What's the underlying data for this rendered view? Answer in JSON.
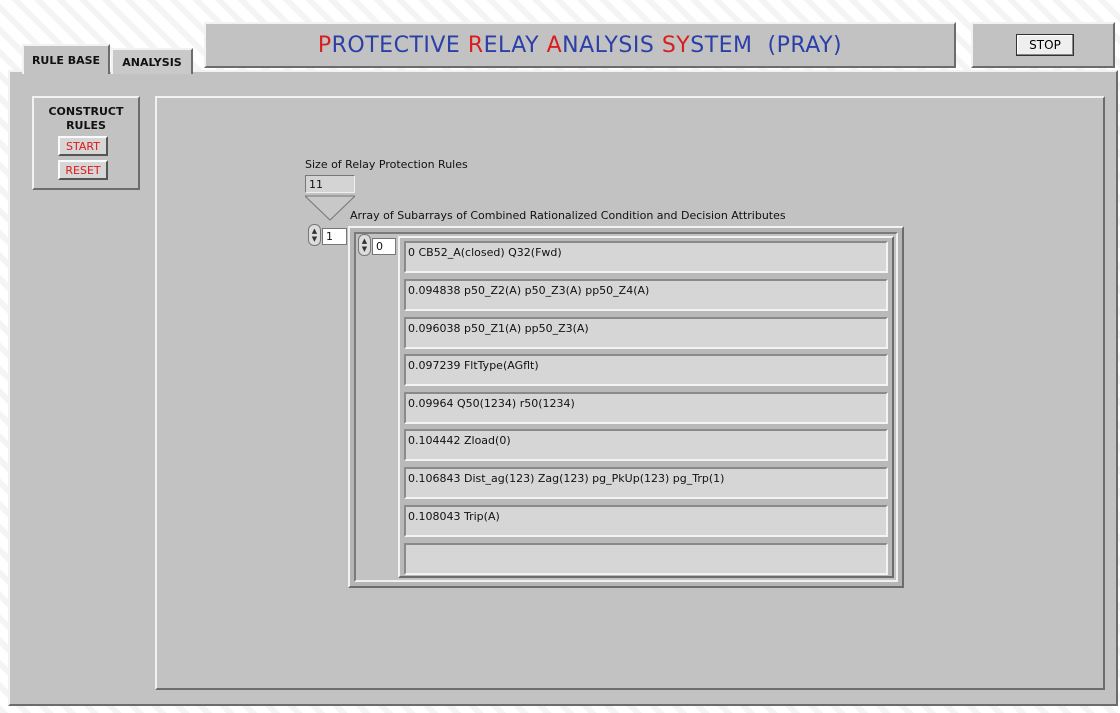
{
  "tabs": [
    {
      "label": "RULE BASE",
      "active": true
    },
    {
      "label": "ANALYSIS",
      "active": false
    }
  ],
  "title_segments": [
    {
      "text": "P",
      "color": "red"
    },
    {
      "text": "ROTECTIVE ",
      "color": "blue"
    },
    {
      "text": "R",
      "color": "red"
    },
    {
      "text": "ELAY ",
      "color": "blue"
    },
    {
      "text": "A",
      "color": "red"
    },
    {
      "text": "NALYSIS ",
      "color": "blue"
    },
    {
      "text": "SY",
      "color": "red"
    },
    {
      "text": "STEM  (PRAY)",
      "color": "blue"
    }
  ],
  "stop_label": "STOP",
  "construct": {
    "heading_line1": "CONSTRUCT",
    "heading_line2": "RULES",
    "start_label": "START",
    "reset_label": "RESET"
  },
  "size_label": "Size of Relay Protection Rules",
  "size_value": "11",
  "array_label": "Array of Subarrays of Combined  Rationalized Condition and Decision Attributes",
  "outer_index": "1",
  "inner_index": "0",
  "rows": [
    "0 CB52_A(closed) Q32(Fwd)",
    "0.094838 p50_Z2(A) p50_Z3(A) pp50_Z4(A)",
    "0.096038 p50_Z1(A) pp50_Z3(A)",
    "0.097239 FltType(AGflt)",
    "0.09964 Q50(1234) r50(1234)",
    "0.104442 Zload(0)",
    "0.106843 Dist_ag(123) Zag(123) pg_PkUp(123) pg_Trp(1)",
    "0.108043 Trip(A)",
    ""
  ],
  "colors": {
    "accent_red": "#d81e1e",
    "accent_blue": "#2a3fa8",
    "panel": "#c2c2c2"
  }
}
